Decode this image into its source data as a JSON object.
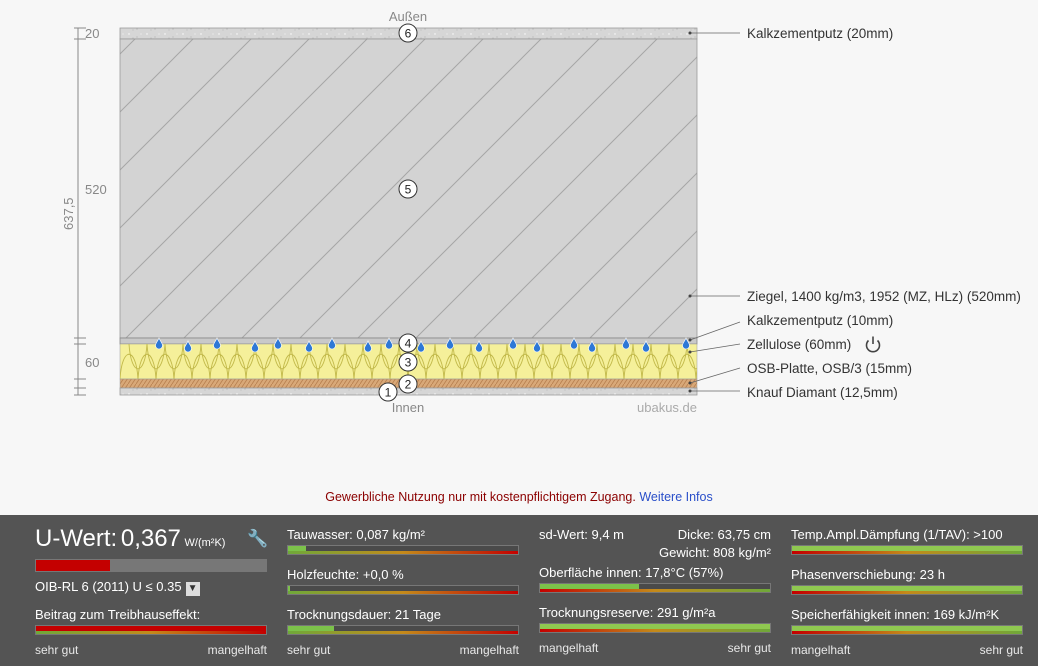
{
  "diagram": {
    "outside_label": "Außen",
    "inside_label": "Innen",
    "watermark": "ubakus.de",
    "dims": {
      "total": "637,5",
      "d20": "20",
      "d520": "520",
      "d60": "60"
    },
    "layer_numbers": [
      "6",
      "5",
      "4",
      "3",
      "2",
      "1"
    ],
    "layers": [
      {
        "label": "Kalkzementputz (20mm)"
      },
      {
        "label": "Ziegel, 1400 kg/m3, 1952 (MZ, HLz) (520mm)"
      },
      {
        "label": "Kalkzementputz (10mm)"
      },
      {
        "label": "Zellulose (60mm)"
      },
      {
        "label": "OSB-Platte, OSB/3 (15mm)"
      },
      {
        "label": "Knauf Diamant (12,5mm)"
      }
    ],
    "colors": {
      "plaster": "#d4d4d4",
      "brick": "#d2d2d2",
      "insulation": "#f3ee98",
      "osb": "#d7a877",
      "drop": "#2e78d6"
    }
  },
  "notice": {
    "text": "Gewerbliche Nutzung nur mit kostenpflichtigem Zugang.",
    "link": "Weitere Infos"
  },
  "panel": {
    "uwert": {
      "label": "U-Wert:",
      "value": "0,367",
      "unit": "W/(m²K)",
      "norm": "OIB-RL 6 (2011) U ≤ 0.35",
      "level": 0.32
    },
    "greenhouse": {
      "label": "Beitrag zum Treibhauseffekt:",
      "level": 1.0
    },
    "scale_left": {
      "good": "sehr gut",
      "bad": "mangelhaft"
    },
    "scale_right": {
      "bad": "mangelhaft",
      "good": "sehr gut"
    },
    "tauwasser": {
      "label": "Tauwasser: 0,087 kg/m²",
      "level": 0.08
    },
    "holzfeuchte": {
      "label": "Holzfeuchte: +0,0 %",
      "level": 0.01
    },
    "trocknungsdauer": {
      "label": "Trocknungsdauer: 21 Tage",
      "level": 0.2
    },
    "sdwert": {
      "label": "sd-Wert: 9,4 m"
    },
    "dicke": {
      "label": "Dicke: 63,75 cm"
    },
    "gewicht": {
      "label": "Gewicht: 808 kg/m²"
    },
    "oberflaeche": {
      "label": "Oberfläche innen: 17,8°C (57%)",
      "level": 0.43
    },
    "trocknungsreserve": {
      "label": "Trocknungsreserve: 291 g/m²a",
      "level": 1.0
    },
    "tav": {
      "label": "Temp.Ampl.Dämpfung (1/TAV): >100",
      "level": 1.0
    },
    "phase": {
      "label": "Phasenverschiebung: 23 h",
      "level": 1.0
    },
    "speicher": {
      "label": "Speicherfähigkeit innen: 169 kJ/m²K",
      "level": 1.0
    }
  }
}
